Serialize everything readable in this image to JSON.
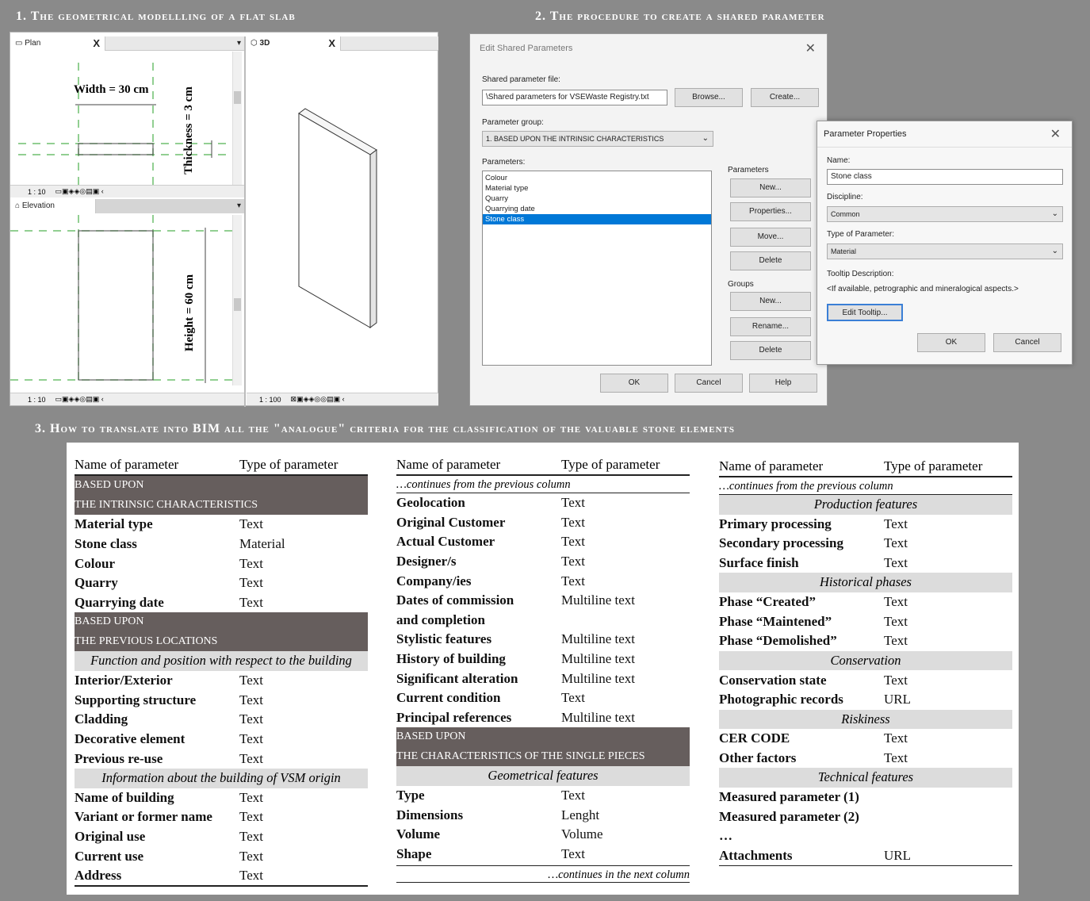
{
  "titles": {
    "s1": "1. The geometrical modellling of a flat slab",
    "s2": "2. The procedure to create a shared parameter",
    "s3": "3. How to translate into BIM all the \"analogue\" criteria for the classification of the valuable stone elements"
  },
  "revit": {
    "plan_tab": "Plan",
    "view3d_tab": "3D",
    "elevation_tab": "Elevation",
    "scale_plan": "1 : 10",
    "scale_elev": "1 : 10",
    "scale_3d": "1 : 100",
    "width_label": "Width = 30 cm",
    "thickness_label": "Thickness = 3 cm",
    "height_label": "Height = 60 cm",
    "close_glyph": "X"
  },
  "esp": {
    "title": "Edit Shared Parameters",
    "file_label": "Shared parameter file:",
    "file_value": "\\Shared parameters for VSEWaste Registry.txt",
    "browse": "Browse...",
    "create": "Create...",
    "group_label": "Parameter group:",
    "group_value": "1. BASED UPON THE INTRINSIC CHARACTERISTICS",
    "params_label": "Parameters:",
    "params": [
      "Colour",
      "Material type",
      "Quarry",
      "Quarrying date",
      "Stone class"
    ],
    "params_group": "Parameters",
    "new": "New...",
    "properties": "Properties...",
    "move": "Move...",
    "delete": "Delete",
    "groups_group": "Groups",
    "gnew": "New...",
    "rename": "Rename...",
    "gdelete": "Delete",
    "ok": "OK",
    "cancel": "Cancel",
    "help": "Help"
  },
  "pp": {
    "title": "Parameter Properties",
    "name_label": "Name:",
    "name_value": "Stone class",
    "discipline_label": "Discipline:",
    "discipline_value": "Common",
    "type_label": "Type of Parameter:",
    "type_value": "Material",
    "tooltip_label": "Tooltip Description:",
    "tooltip_value": "<If available, petrographic and mineralogical aspects.>",
    "edit_tooltip": "Edit Tooltip...",
    "ok": "OK",
    "cancel": "Cancel"
  },
  "table": {
    "h1": "Name of parameter",
    "h2": "Type of parameter",
    "cont_prev": "…continues from the previous column",
    "cont_next": "…continues in the next column",
    "col1": [
      {
        "k": "dark",
        "t": "BASED UPON"
      },
      {
        "k": "dark",
        "t": "THE INTRINSIC CHARACTERISTICS"
      },
      {
        "k": "row",
        "n": "Material type",
        "v": "Text"
      },
      {
        "k": "row",
        "n": "Stone class",
        "v": "Material"
      },
      {
        "k": "row",
        "n": "Colour",
        "v": "Text"
      },
      {
        "k": "row",
        "n": "Quarry",
        "v": "Text"
      },
      {
        "k": "row",
        "n": "Quarrying date",
        "v": "Text"
      },
      {
        "k": "dark",
        "t": "BASED UPON"
      },
      {
        "k": "dark",
        "t": "THE PREVIOUS LOCATIONS"
      },
      {
        "k": "grey",
        "t": "Function and position with respect to the building"
      },
      {
        "k": "row",
        "n": "Interior/Exterior",
        "v": "Text"
      },
      {
        "k": "row",
        "n": "Supporting structure",
        "v": "Text"
      },
      {
        "k": "row",
        "n": "Cladding",
        "v": "Text"
      },
      {
        "k": "row",
        "n": "Decorative element",
        "v": "Text"
      },
      {
        "k": "row",
        "n": "Previous re-use",
        "v": "Text"
      },
      {
        "k": "grey",
        "t": "Information about the building of VSM origin"
      },
      {
        "k": "row",
        "n": "Name of building",
        "v": "Text"
      },
      {
        "k": "row",
        "n": "Variant or former name",
        "v": "Text"
      },
      {
        "k": "row",
        "n": "Original use",
        "v": "Text"
      },
      {
        "k": "row",
        "n": "Current use",
        "v": "Text"
      },
      {
        "k": "row",
        "n": "Address",
        "v": "Text"
      }
    ],
    "col2": [
      {
        "k": "row",
        "n": "Geolocation",
        "v": "Text"
      },
      {
        "k": "row",
        "n": "Original Customer",
        "v": "Text"
      },
      {
        "k": "row",
        "n": "Actual Customer",
        "v": "Text"
      },
      {
        "k": "row",
        "n": "Designer/s",
        "v": "Text"
      },
      {
        "k": "row",
        "n": "Company/ies",
        "v": "Text"
      },
      {
        "k": "row",
        "n": "Dates of commission",
        "v": "Multiline text"
      },
      {
        "k": "row",
        "n": "and completion",
        "v": ""
      },
      {
        "k": "row",
        "n": "Stylistic features",
        "v": "Multiline text"
      },
      {
        "k": "row",
        "n": "History of building",
        "v": "Multiline text"
      },
      {
        "k": "row",
        "n": "Significant alteration",
        "v": "Multiline text"
      },
      {
        "k": "row",
        "n": "Current condition",
        "v": "Text"
      },
      {
        "k": "row",
        "n": "Principal references",
        "v": "Multiline text"
      },
      {
        "k": "dark",
        "t": "BASED UPON"
      },
      {
        "k": "dark",
        "t": "THE CHARACTERISTICS OF THE SINGLE PIECES"
      },
      {
        "k": "grey",
        "t": "Geometrical features"
      },
      {
        "k": "row",
        "n": "Type",
        "v": "Text"
      },
      {
        "k": "row",
        "n": "Dimensions",
        "v": "Lenght"
      },
      {
        "k": "row",
        "n": "Volume",
        "v": "Volume"
      },
      {
        "k": "row",
        "n": "Shape",
        "v": "Text"
      }
    ],
    "col3": [
      {
        "k": "grey",
        "t": "Production features"
      },
      {
        "k": "row",
        "n": "Primary processing",
        "v": "Text"
      },
      {
        "k": "row",
        "n": "Secondary processing",
        "v": "Text"
      },
      {
        "k": "row",
        "n": "Surface finish",
        "v": "Text"
      },
      {
        "k": "grey",
        "t": "Historical phases"
      },
      {
        "k": "row",
        "n": "Phase “Created”",
        "v": "Text"
      },
      {
        "k": "row",
        "n": "Phase “Maintened”",
        "v": "Text"
      },
      {
        "k": "row",
        "n": "Phase “Demolished”",
        "v": "Text"
      },
      {
        "k": "grey",
        "t": "Conservation"
      },
      {
        "k": "row",
        "n": "Conservation state",
        "v": "Text"
      },
      {
        "k": "row",
        "n": "Photographic records",
        "v": "URL"
      },
      {
        "k": "grey",
        "t": "Riskiness"
      },
      {
        "k": "row",
        "n": "CER CODE",
        "v": "Text"
      },
      {
        "k": "row",
        "n": "Other factors",
        "v": "Text"
      },
      {
        "k": "grey",
        "t": "Technical features"
      },
      {
        "k": "row",
        "n": "Measured parameter (1)",
        "v": ""
      },
      {
        "k": "row",
        "n": "Measured parameter (2)",
        "v": ""
      },
      {
        "k": "row",
        "n": "…",
        "v": ""
      },
      {
        "k": "row",
        "n": "Attachments",
        "v": "URL"
      }
    ]
  }
}
